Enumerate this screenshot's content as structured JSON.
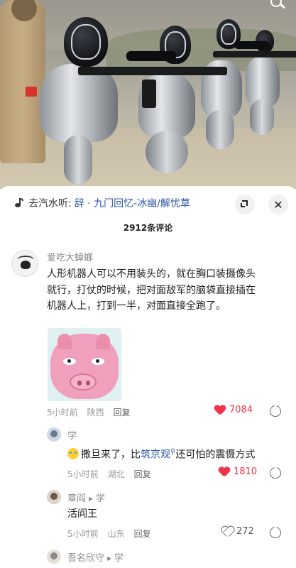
{
  "music": {
    "prefix": "去汽水听:",
    "title": "辞 · 九门回忆-冰幽/解忧草"
  },
  "comment_count": "2912条评论",
  "comments": [
    {
      "username": "爱吃大蟑螂",
      "text_lines": [
        "人形机器人可以不用装头的，就在胸口装摄像头",
        "就行，打仗的时候，把对面敌军的脑袋直接插在",
        "机器人上，打到一半，对面直接全跑了。"
      ],
      "time": "5小时前",
      "location": "陕西",
      "reply_label": "回复",
      "likes": "7084",
      "liked": true
    },
    {
      "username": "学",
      "text_before": "撒旦来了，比",
      "text_link": "筑京观",
      "text_after": "还可怕的震慑方式",
      "time": "5小时前",
      "location": "湖北",
      "reply_label": "回复",
      "likes": "1810",
      "liked": true
    },
    {
      "username": "章阎",
      "reply_to": "学",
      "text": "活阎王",
      "time": "5小时前",
      "location": "山东",
      "reply_label": "回复",
      "likes": "272",
      "liked": false
    },
    {
      "username": "吾名欣守",
      "reply_to": "学"
    }
  ],
  "colors": {
    "accent_link": "#2d56a8",
    "like_red": "#f0344e",
    "meta_gray": "#9a9a9a"
  },
  "icons": [
    "search-icon",
    "music-note-icon",
    "fit-screen-icon",
    "close-icon",
    "heart-icon",
    "dislike-icon"
  ]
}
